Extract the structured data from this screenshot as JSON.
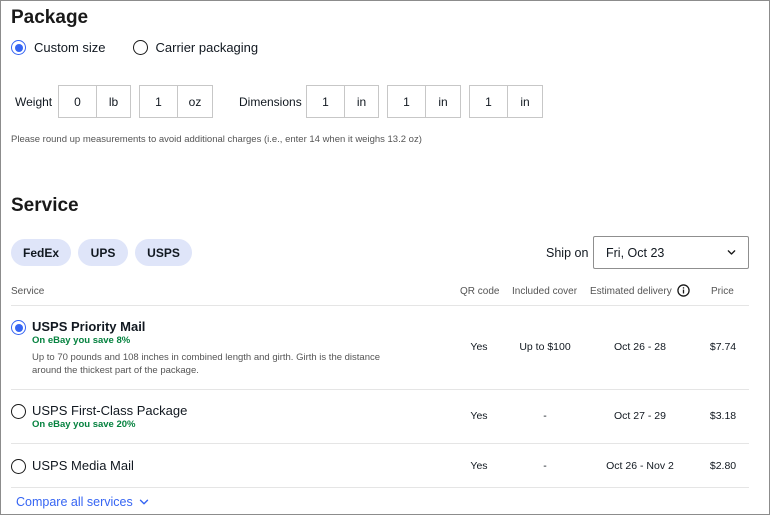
{
  "package": {
    "title": "Package",
    "options": [
      {
        "label": "Custom size",
        "selected": true
      },
      {
        "label": "Carrier packaging",
        "selected": false
      }
    ],
    "weight": {
      "label": "Weight",
      "lb_value": "0",
      "lb_unit": "lb",
      "oz_value": "1",
      "oz_unit": "oz"
    },
    "dimensions": {
      "label": "Dimensions",
      "fields": [
        {
          "value": "1",
          "unit": "in"
        },
        {
          "value": "1",
          "unit": "in"
        },
        {
          "value": "1",
          "unit": "in"
        }
      ]
    },
    "hint": "Please round up measurements to avoid additional charges (i.e., enter 14 when it weighs 13.2 oz)"
  },
  "service": {
    "title": "Service",
    "carriers": [
      "FedEx",
      "UPS",
      "USPS"
    ],
    "ship_on_label": "Ship on",
    "ship_on_value": "Fri, Oct 23",
    "columns": {
      "service": "Service",
      "qr": "QR code",
      "cover": "Included cover",
      "delivery": "Estimated delivery",
      "price": "Price"
    },
    "rows": [
      {
        "name": "USPS Priority Mail",
        "selected": true,
        "savings": "On eBay you save 8%",
        "description": "Up to 70 pounds and 108 inches in combined length and girth. Girth is the distance around the thickest part of the package.",
        "qr": "Yes",
        "cover": "Up to $100",
        "delivery": "Oct 26 - 28",
        "price": "$7.74"
      },
      {
        "name": "USPS First-Class Package",
        "selected": false,
        "savings": "On eBay you save 20%",
        "description": "",
        "qr": "Yes",
        "cover": "-",
        "delivery": "Oct 27 - 29",
        "price": "$3.18"
      },
      {
        "name": "USPS Media Mail",
        "selected": false,
        "savings": "",
        "description": "",
        "qr": "Yes",
        "cover": "-",
        "delivery": "Oct 26 - Nov 2",
        "price": "$2.80"
      }
    ],
    "compare_link": "Compare all services"
  },
  "colors": {
    "accent": "#3665f3",
    "savings": "#05823f",
    "chip_bg": "#dfe5f9"
  },
  "icons": [
    "radio-selected-icon",
    "radio-unselected-icon",
    "chevron-down-icon",
    "info-icon"
  ]
}
